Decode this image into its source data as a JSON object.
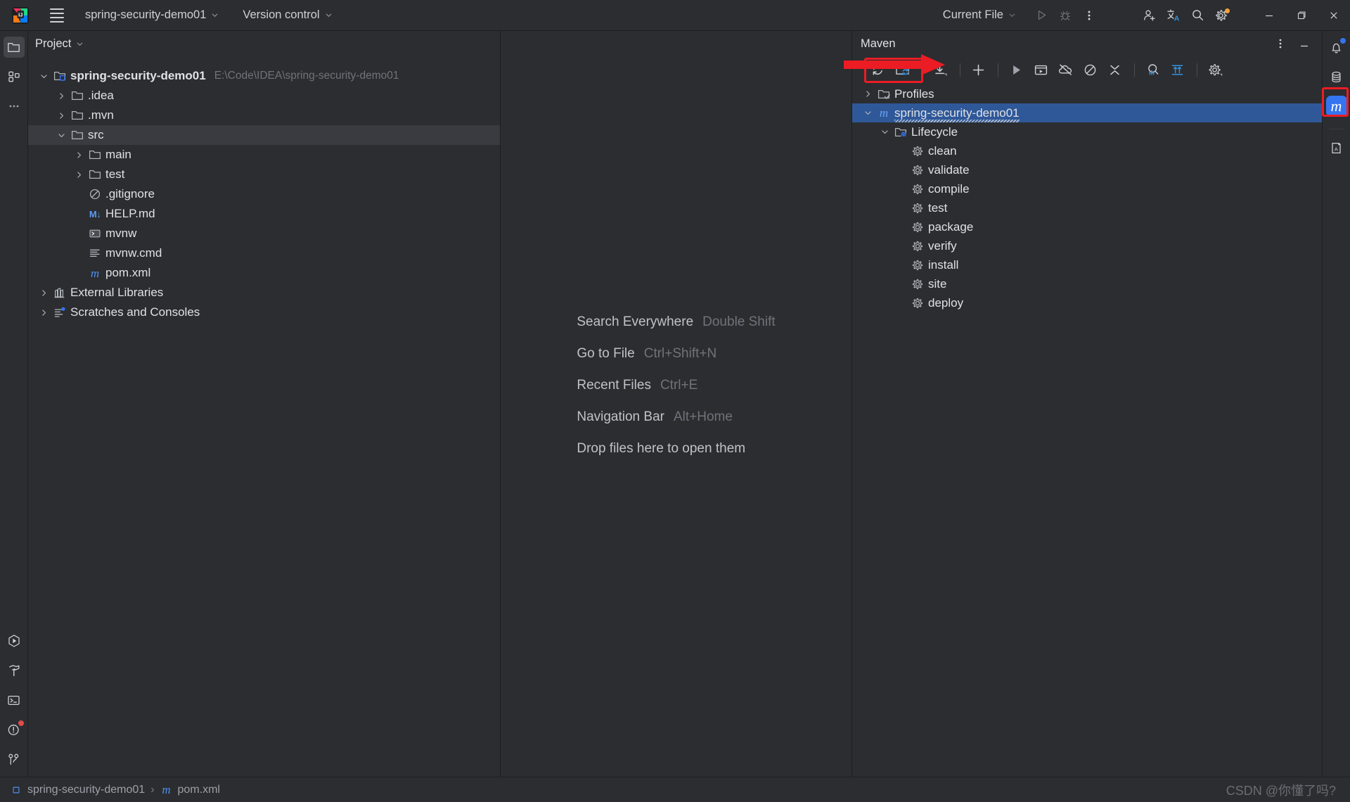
{
  "window": {
    "app_icon": "intellij-idea-logo",
    "menu_icon": "hamburger-menu-icon",
    "project_name": "spring-security-demo01",
    "vcs_label": "Version control",
    "run_config": "Current File",
    "run_icon": "run-icon",
    "debug_icon": "debug-icon",
    "more_icon": "more-vertical-icon",
    "account_icon": "add-user-icon",
    "translate_icon": "translate-icon",
    "search_icon": "search-icon",
    "settings_icon": "gear-icon",
    "minimize": "minimize-icon",
    "maximize": "maximize-icon",
    "close": "close-icon"
  },
  "left_stripe": {
    "top": [
      {
        "name": "project-tool-icon",
        "label": "Project",
        "active": true
      },
      {
        "name": "structure-tool-icon",
        "label": "Structure",
        "active": false
      },
      {
        "name": "more-tool-windows-icon",
        "label": "More tool windows",
        "active": false
      }
    ],
    "bottom": [
      {
        "name": "run-tool-icon",
        "label": "Run",
        "badge": ""
      },
      {
        "name": "build-tool-icon",
        "label": "Build",
        "badge": ""
      },
      {
        "name": "terminal-tool-icon",
        "label": "Terminal",
        "badge": ""
      },
      {
        "name": "problems-tool-icon",
        "label": "Problems",
        "badge": "red"
      },
      {
        "name": "git-tool-icon",
        "label": "Git",
        "badge": ""
      }
    ]
  },
  "right_stripe": {
    "items": [
      {
        "name": "notifications-icon",
        "label": "Notifications",
        "badge": "blue"
      },
      {
        "name": "database-icon",
        "label": "Database",
        "badge": ""
      },
      {
        "name": "maven-icon",
        "label": "Maven",
        "badge": "",
        "selected": true,
        "highlighted": true
      },
      {
        "name": "dictionary-icon",
        "label": "Dictionary",
        "badge": ""
      }
    ]
  },
  "project_panel": {
    "title": "Project",
    "tree": [
      {
        "indent": 0,
        "arrow": "down",
        "icon": "project-module-icon",
        "label": "spring-security-demo01",
        "bold": true,
        "path": "E:\\Code\\IDEA\\spring-security-demo01",
        "selected": false
      },
      {
        "indent": 1,
        "arrow": "right",
        "icon": "folder-icon",
        "label": ".idea",
        "bold": false,
        "path": "",
        "selected": false
      },
      {
        "indent": 1,
        "arrow": "right",
        "icon": "folder-icon",
        "label": ".mvn",
        "bold": false,
        "path": "",
        "selected": false
      },
      {
        "indent": 1,
        "arrow": "down",
        "icon": "folder-icon",
        "label": "src",
        "bold": false,
        "path": "",
        "selected": true
      },
      {
        "indent": 2,
        "arrow": "right",
        "icon": "folder-icon",
        "label": "main",
        "bold": false,
        "path": "",
        "selected": false
      },
      {
        "indent": 2,
        "arrow": "right",
        "icon": "folder-icon",
        "label": "test",
        "bold": false,
        "path": "",
        "selected": false
      },
      {
        "indent": 2,
        "arrow": "none",
        "icon": "gitignore-icon",
        "label": ".gitignore",
        "bold": false,
        "path": "",
        "selected": false
      },
      {
        "indent": 2,
        "arrow": "none",
        "icon": "markdown-icon",
        "label": "HELP.md",
        "bold": false,
        "path": "",
        "selected": false
      },
      {
        "indent": 2,
        "arrow": "none",
        "icon": "shell-script-icon",
        "label": "mvnw",
        "bold": false,
        "path": "",
        "selected": false
      },
      {
        "indent": 2,
        "arrow": "none",
        "icon": "text-file-icon",
        "label": "mvnw.cmd",
        "bold": false,
        "path": "",
        "selected": false
      },
      {
        "indent": 2,
        "arrow": "none",
        "icon": "maven-pom-icon",
        "label": "pom.xml",
        "bold": false,
        "path": "",
        "selected": false
      },
      {
        "indent": 0,
        "arrow": "right",
        "icon": "external-libraries-icon",
        "label": "External Libraries",
        "bold": false,
        "path": "",
        "selected": false
      },
      {
        "indent": 0,
        "arrow": "right",
        "icon": "scratches-icon",
        "label": "Scratches and Consoles",
        "bold": false,
        "path": "",
        "selected": false
      }
    ]
  },
  "editor": {
    "hints": [
      {
        "name": "Search Everywhere",
        "key": "Double Shift"
      },
      {
        "name": "Go to File",
        "key": "Ctrl+Shift+N"
      },
      {
        "name": "Recent Files",
        "key": "Ctrl+E"
      },
      {
        "name": "Navigation Bar",
        "key": "Alt+Home"
      },
      {
        "name": "Drop files here to open them",
        "key": ""
      }
    ]
  },
  "maven_panel": {
    "title": "Maven",
    "options_icon": "more-vertical-icon",
    "hide_icon": "minimize-icon",
    "toolbar": [
      {
        "name": "reload-all-maven-projects-icon",
        "label": "Reload All Maven Projects",
        "group": 0,
        "highlighted": true
      },
      {
        "name": "add-maven-project-icon",
        "label": "Add Maven Project",
        "group": 0,
        "highlighted": true
      },
      {
        "name": "download-sources-icon",
        "label": "Download Sources and/or Documentation",
        "group": 1,
        "highlighted": false
      },
      {
        "name": "add-icon",
        "label": "Add",
        "group": 2,
        "highlighted": false
      },
      {
        "name": "run-maven-build-icon",
        "label": "Run Maven Build",
        "group": 3,
        "highlighted": false
      },
      {
        "name": "execute-maven-goal-icon",
        "label": "Execute Maven Goal",
        "group": 3,
        "highlighted": false
      },
      {
        "name": "toggle-offline-mode-icon",
        "label": "Toggle Offline Mode",
        "group": 3,
        "highlighted": false
      },
      {
        "name": "toggle-skip-tests-icon",
        "label": "Toggle 'Skip Tests' Mode",
        "group": 3,
        "highlighted": false
      },
      {
        "name": "collapse-all-icon",
        "label": "Collapse All",
        "group": 3,
        "highlighted": false
      },
      {
        "name": "show-dependencies-icon",
        "label": "Show Dependencies",
        "group": 4,
        "highlighted": false
      },
      {
        "name": "expand-dependencies-icon",
        "label": "Show Dependencies Analyzer",
        "group": 4,
        "highlighted": false
      },
      {
        "name": "maven-settings-icon",
        "label": "Maven Settings",
        "group": 5,
        "highlighted": false
      }
    ],
    "tree": [
      {
        "indent": 0,
        "arrow": "right",
        "icon": "profiles-folder-icon",
        "label": "Profiles",
        "selected": false,
        "squiggle": false
      },
      {
        "indent": 0,
        "arrow": "down",
        "icon": "maven-project-icon",
        "label": "spring-security-demo01",
        "selected": true,
        "squiggle": true
      },
      {
        "indent": 1,
        "arrow": "down",
        "icon": "lifecycle-folder-icon",
        "label": "Lifecycle",
        "selected": false,
        "squiggle": false
      },
      {
        "indent": 2,
        "arrow": "none",
        "icon": "maven-goal-icon",
        "label": "clean",
        "selected": false,
        "squiggle": false
      },
      {
        "indent": 2,
        "arrow": "none",
        "icon": "maven-goal-icon",
        "label": "validate",
        "selected": false,
        "squiggle": false
      },
      {
        "indent": 2,
        "arrow": "none",
        "icon": "maven-goal-icon",
        "label": "compile",
        "selected": false,
        "squiggle": false
      },
      {
        "indent": 2,
        "arrow": "none",
        "icon": "maven-goal-icon",
        "label": "test",
        "selected": false,
        "squiggle": false
      },
      {
        "indent": 2,
        "arrow": "none",
        "icon": "maven-goal-icon",
        "label": "package",
        "selected": false,
        "squiggle": false
      },
      {
        "indent": 2,
        "arrow": "none",
        "icon": "maven-goal-icon",
        "label": "verify",
        "selected": false,
        "squiggle": false
      },
      {
        "indent": 2,
        "arrow": "none",
        "icon": "maven-goal-icon",
        "label": "install",
        "selected": false,
        "squiggle": false
      },
      {
        "indent": 2,
        "arrow": "none",
        "icon": "maven-goal-icon",
        "label": "site",
        "selected": false,
        "squiggle": false
      },
      {
        "indent": 2,
        "arrow": "none",
        "icon": "maven-goal-icon",
        "label": "deploy",
        "selected": false,
        "squiggle": false
      }
    ]
  },
  "status_bar": {
    "breadcrumb": [
      {
        "icon": "module-icon",
        "label": "spring-security-demo01"
      },
      {
        "icon": "maven-pom-icon",
        "label": "pom.xml"
      }
    ],
    "separator": "›",
    "watermark": "CSDN @你懂了吗?"
  },
  "annotations": {
    "arrow_color": "#ec1c24",
    "box_color": "#ec1c24",
    "arrow_name": "red-pointer-arrow",
    "boxes": [
      {
        "name": "maven-reload-buttons-highlight"
      },
      {
        "name": "maven-stripe-icon-highlight"
      }
    ]
  },
  "colors": {
    "bg": "#2b2d30",
    "selection_blue": "#2f5899",
    "accent_blue": "#3574f0",
    "text": "#dfe1e5",
    "muted": "#6f737a"
  }
}
